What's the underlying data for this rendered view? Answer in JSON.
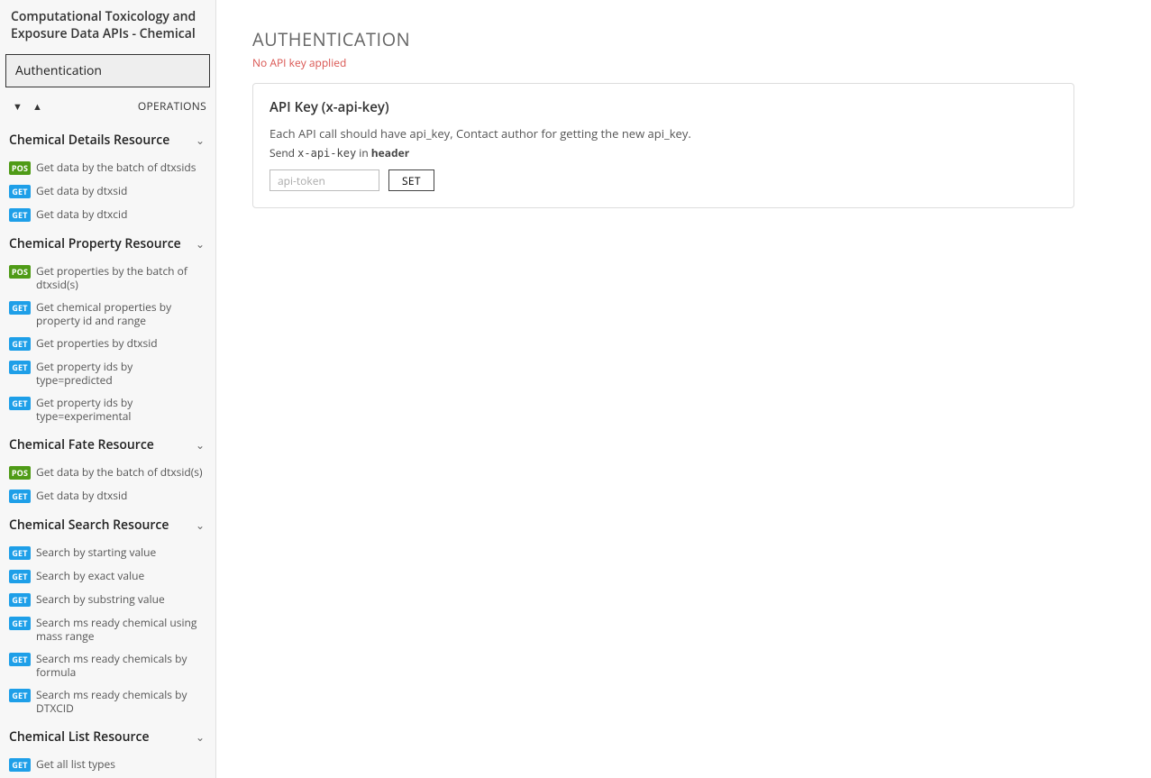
{
  "sidebar": {
    "title": "Computational Toxicology and Exposure Data APIs - Chemical",
    "auth_label": "Authentication",
    "ops_label": "OPERATIONS",
    "sort_down": "▼",
    "sort_up": "▲",
    "sections": [
      {
        "title": "Chemical Details Resource",
        "items": [
          {
            "method": "POS",
            "type": "post",
            "label": "Get data by the batch of dtxsids"
          },
          {
            "method": "GET",
            "type": "get",
            "label": "Get data by dtxsid"
          },
          {
            "method": "GET",
            "type": "get",
            "label": "Get data by dtxcid"
          }
        ]
      },
      {
        "title": "Chemical Property Resource",
        "items": [
          {
            "method": "POS",
            "type": "post",
            "label": "Get properties by the batch of dtxsid(s)"
          },
          {
            "method": "GET",
            "type": "get",
            "label": "Get chemical properties by property id and range"
          },
          {
            "method": "GET",
            "type": "get",
            "label": "Get properties by dtxsid"
          },
          {
            "method": "GET",
            "type": "get",
            "label": "Get property ids by type=predicted"
          },
          {
            "method": "GET",
            "type": "get",
            "label": "Get property ids by type=experimental"
          }
        ]
      },
      {
        "title": "Chemical Fate Resource",
        "items": [
          {
            "method": "POS",
            "type": "post",
            "label": "Get data by the batch of dtxsid(s)"
          },
          {
            "method": "GET",
            "type": "get",
            "label": "Get data by dtxsid"
          }
        ]
      },
      {
        "title": "Chemical Search Resource",
        "items": [
          {
            "method": "GET",
            "type": "get",
            "label": "Search by starting value"
          },
          {
            "method": "GET",
            "type": "get",
            "label": "Search by exact value"
          },
          {
            "method": "GET",
            "type": "get",
            "label": "Search by substring value"
          },
          {
            "method": "GET",
            "type": "get",
            "label": "Search ms ready chemical using mass range"
          },
          {
            "method": "GET",
            "type": "get",
            "label": "Search ms ready chemicals by formula"
          },
          {
            "method": "GET",
            "type": "get",
            "label": "Search ms ready chemicals by DTXCID"
          }
        ]
      },
      {
        "title": "Chemical List Resource",
        "items": [
          {
            "method": "GET",
            "type": "get",
            "label": "Get all list types"
          }
        ]
      }
    ]
  },
  "main": {
    "heading": "AUTHENTICATION",
    "warning": "No API key applied",
    "card": {
      "title": "API Key (x-api-key)",
      "desc": "Each API call should have api_key, Contact author for getting the new api_key.",
      "sub_prefix": "Send ",
      "sub_code": "x-api-key",
      "sub_mid": " in ",
      "sub_bold": "header",
      "placeholder": "api-token",
      "button": "SET"
    }
  }
}
